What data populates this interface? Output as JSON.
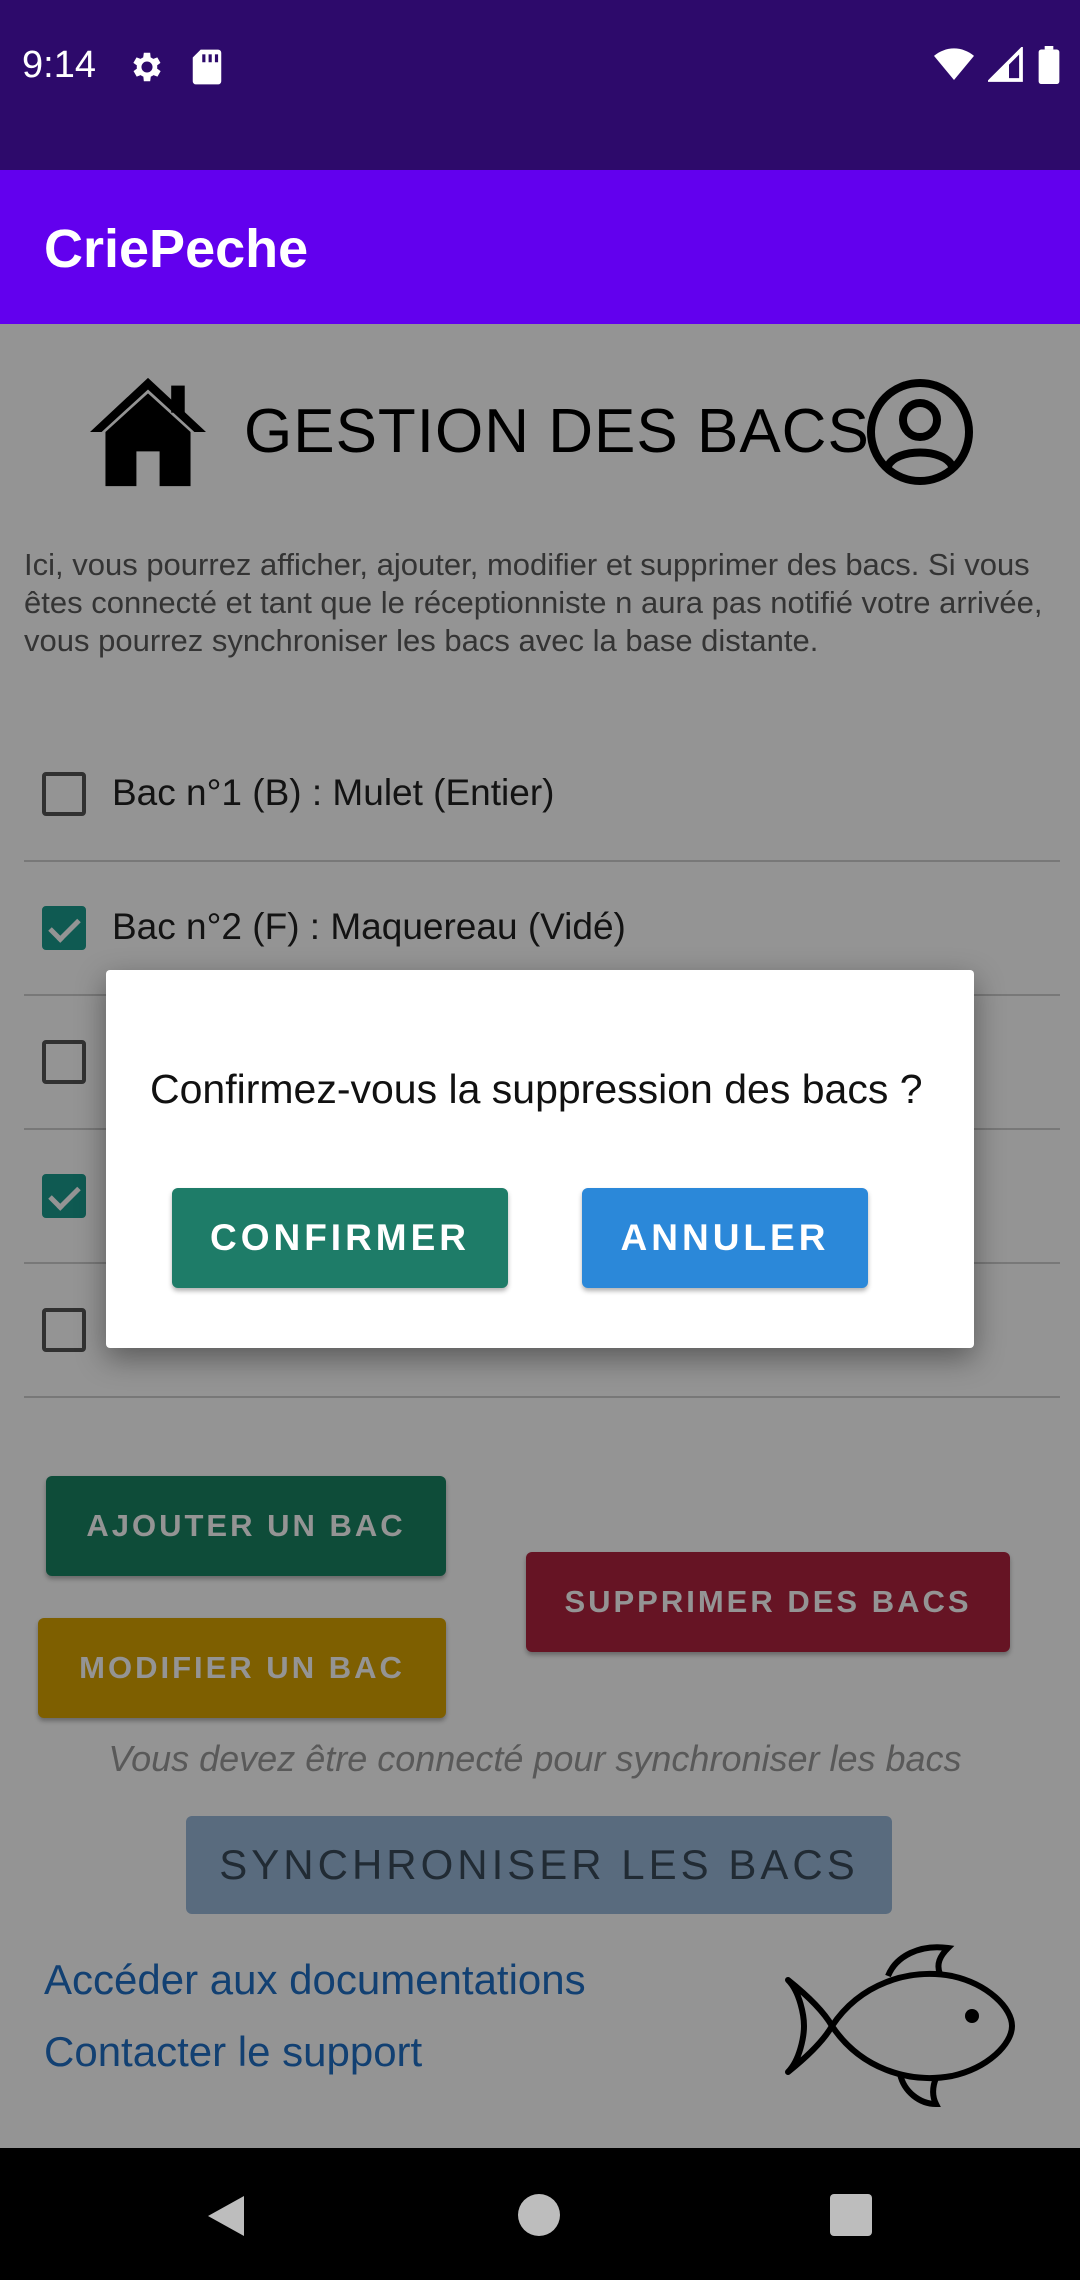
{
  "status_bar": {
    "time": "9:14",
    "left_icons": [
      "gear-icon",
      "sd-card-icon"
    ],
    "right_icons": [
      "wifi-icon",
      "signal-icon",
      "battery-icon"
    ]
  },
  "app_bar": {
    "title": "CriePeche"
  },
  "page": {
    "title": "GESTION DES BACS",
    "intro": "Ici, vous pourrez afficher, ajouter, modifier et supprimer des bacs. Si vous êtes connecté et tant que le réceptionniste n aura pas notifié votre arrivée, vous pourrez synchroniser les bacs avec la base distante."
  },
  "bacs": [
    {
      "label": "Bac n°1 (B) : Mulet (Entier)",
      "checked": false
    },
    {
      "label": "Bac n°2 (F) : Maquereau (Vidé)",
      "checked": true
    },
    {
      "label": "",
      "checked": false
    },
    {
      "label": "",
      "checked": true
    },
    {
      "label": "",
      "checked": false
    }
  ],
  "actions": {
    "add": "AJOUTER UN BAC",
    "edit": "MODIFIER UN BAC",
    "delete": "SUPPRIMER DES BACS",
    "sync_note": "Vous devez être connecté pour synchroniser les bacs",
    "sync": "SYNCHRONISER LES BACS"
  },
  "links": {
    "docs": "Accéder aux documentations",
    "support": "Contacter le support"
  },
  "dialog": {
    "message": "Confirmez-vous la suppression des bacs ?",
    "confirm": "CONFIRMER",
    "cancel": "ANNULER"
  },
  "colors": {
    "status_bar": "#2d0a6b",
    "app_bar": "#6200ee",
    "confirm": "#1e7c68",
    "cancel": "#2b88d9",
    "checkbox_checked": "#1a9c8e"
  }
}
